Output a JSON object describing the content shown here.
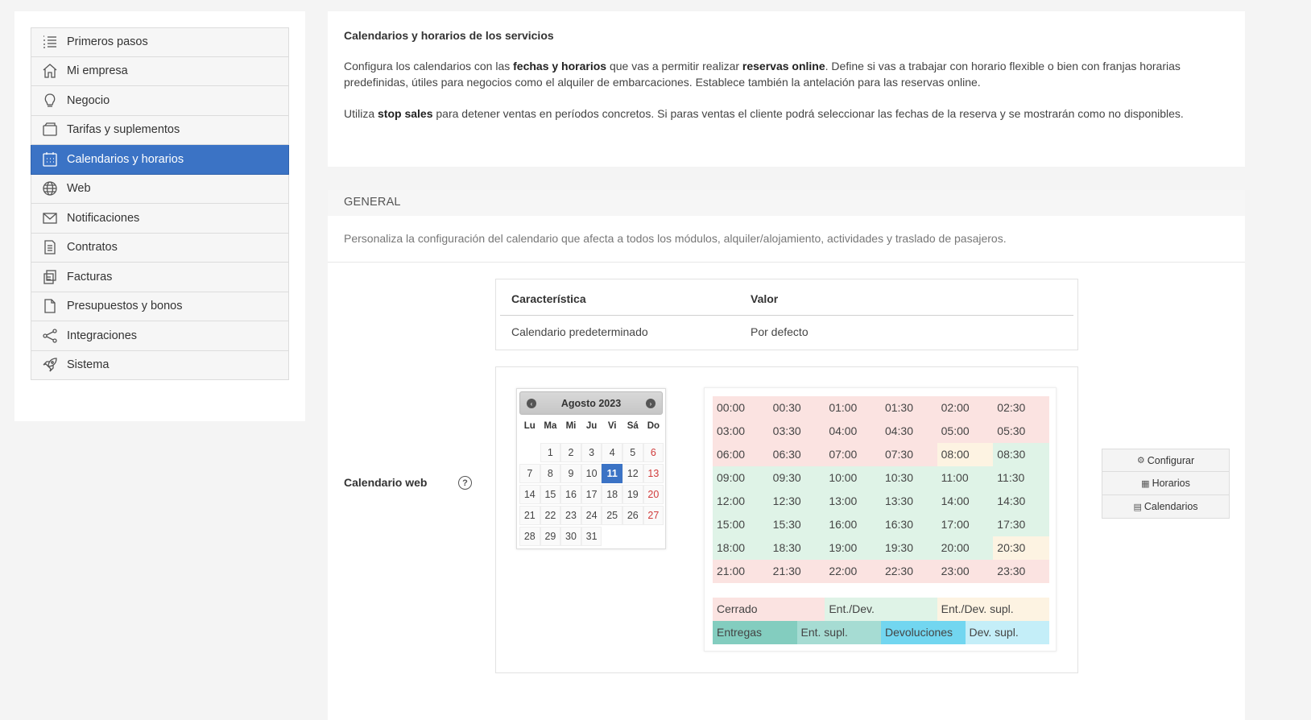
{
  "sidebar": {
    "items": [
      {
        "label": "Primeros pasos",
        "icon": "list-numbered-icon",
        "active": false
      },
      {
        "label": "Mi empresa",
        "icon": "home-icon",
        "active": false
      },
      {
        "label": "Negocio",
        "icon": "lightbulb-icon",
        "active": false
      },
      {
        "label": "Tarifas y suplementos",
        "icon": "wallet-icon",
        "active": false
      },
      {
        "label": "Calendarios y horarios",
        "icon": "calendar-icon",
        "active": true
      },
      {
        "label": "Web",
        "icon": "globe-icon",
        "active": false
      },
      {
        "label": "Notificaciones",
        "icon": "envelope-icon",
        "active": false
      },
      {
        "label": "Contratos",
        "icon": "document-icon",
        "active": false
      },
      {
        "label": "Facturas",
        "icon": "invoices-icon",
        "active": false
      },
      {
        "label": "Presupuestos y bonos",
        "icon": "file-icon",
        "active": false
      },
      {
        "label": "Integraciones",
        "icon": "share-icon",
        "active": false
      },
      {
        "label": "Sistema",
        "icon": "rocket-icon",
        "active": false
      }
    ]
  },
  "intro": {
    "title": "Calendarios y horarios de los servicios",
    "p1_a": "Configura los calendarios con las ",
    "p1_b": "fechas y horarios",
    "p1_c": " que vas a permitir realizar ",
    "p1_d": "reservas online",
    "p1_e": ". Define si vas a trabajar con horario flexible o bien con franjas horarias predefinidas, útiles para negocios como el alquiler de embarcaciones. Establece también la antelación para las reservas online.",
    "p2_a": "Utiliza ",
    "p2_b": "stop sales",
    "p2_c": " para detener ventas en períodos concretos. Si paras ventas el cliente podrá seleccionar las fechas de la reserva y se mostrarán como no disponibles."
  },
  "general": {
    "heading": "GENERAL",
    "description": "Personaliza la configuración del calendario que afecta a todos los módulos, alquiler/alojamiento, actividades y traslado de pasajeros."
  },
  "feature_table": {
    "col1": "Característica",
    "col2": "Valor",
    "row_feature": "Calendario predeterminado",
    "row_value": "Por defecto"
  },
  "calendar_web": {
    "label": "Calendario web",
    "help": "?"
  },
  "datepicker": {
    "month": "Agosto 2023",
    "prev": "‹",
    "next": "›",
    "dows": [
      "Lu",
      "Ma",
      "Mi",
      "Ju",
      "Vi",
      "Sá",
      "Do"
    ],
    "weeks": [
      [
        "",
        "1",
        "2",
        "3",
        "4",
        "5",
        "6"
      ],
      [
        "7",
        "8",
        "9",
        "10",
        "11",
        "12",
        "13"
      ],
      [
        "14",
        "15",
        "16",
        "17",
        "18",
        "19",
        "20"
      ],
      [
        "21",
        "22",
        "23",
        "24",
        "25",
        "26",
        "27"
      ],
      [
        "28",
        "29",
        "30",
        "31",
        "",
        "",
        ""
      ]
    ],
    "selected": "11"
  },
  "time_grid": {
    "rows": [
      [
        [
          "00:00",
          "red"
        ],
        [
          "00:30",
          "red"
        ],
        [
          "01:00",
          "red"
        ],
        [
          "01:30",
          "red"
        ],
        [
          "02:00",
          "red"
        ],
        [
          "02:30",
          "red"
        ]
      ],
      [
        [
          "03:00",
          "red"
        ],
        [
          "03:30",
          "red"
        ],
        [
          "04:00",
          "red"
        ],
        [
          "04:30",
          "red"
        ],
        [
          "05:00",
          "red"
        ],
        [
          "05:30",
          "red"
        ]
      ],
      [
        [
          "06:00",
          "red"
        ],
        [
          "06:30",
          "red"
        ],
        [
          "07:00",
          "red"
        ],
        [
          "07:30",
          "red"
        ],
        [
          "08:00",
          "yellow"
        ],
        [
          "08:30",
          "green"
        ]
      ],
      [
        [
          "09:00",
          "green"
        ],
        [
          "09:30",
          "green"
        ],
        [
          "10:00",
          "green"
        ],
        [
          "10:30",
          "green"
        ],
        [
          "11:00",
          "green"
        ],
        [
          "11:30",
          "green"
        ]
      ],
      [
        [
          "12:00",
          "green"
        ],
        [
          "12:30",
          "green"
        ],
        [
          "13:00",
          "green"
        ],
        [
          "13:30",
          "green"
        ],
        [
          "14:00",
          "green"
        ],
        [
          "14:30",
          "green"
        ]
      ],
      [
        [
          "15:00",
          "green"
        ],
        [
          "15:30",
          "green"
        ],
        [
          "16:00",
          "green"
        ],
        [
          "16:30",
          "green"
        ],
        [
          "17:00",
          "green"
        ],
        [
          "17:30",
          "green"
        ]
      ],
      [
        [
          "18:00",
          "green"
        ],
        [
          "18:30",
          "green"
        ],
        [
          "19:00",
          "green"
        ],
        [
          "19:30",
          "green"
        ],
        [
          "20:00",
          "green"
        ],
        [
          "20:30",
          "yellow"
        ]
      ],
      [
        [
          "21:00",
          "red"
        ],
        [
          "21:30",
          "red"
        ],
        [
          "22:00",
          "red"
        ],
        [
          "22:30",
          "red"
        ],
        [
          "23:00",
          "red"
        ],
        [
          "23:30",
          "red"
        ]
      ]
    ]
  },
  "legend": {
    "row1": [
      {
        "label": "Cerrado",
        "color": "#fbe3e1"
      },
      {
        "label": "Ent./Dev.",
        "color": "#dff3e7"
      },
      {
        "label": "Ent./Dev. supl.",
        "color": "#fdf3e2"
      }
    ],
    "row2": [
      {
        "label": "Entregas",
        "color": "#83cdbf"
      },
      {
        "label": "Ent. supl.",
        "color": "#a6dcd3"
      },
      {
        "label": "Devoluciones",
        "color": "#72d6f0"
      },
      {
        "label": "Dev. supl.",
        "color": "#c4eef8"
      }
    ]
  },
  "actions": {
    "configure": "Configurar",
    "schedules": "Horarios",
    "calendars": "Calendarios"
  },
  "colors": {
    "accent": "#3b73c5",
    "closed": "#fbe3e1",
    "open": "#dff3e7",
    "supplement": "#fdf3e2",
    "sunday": "#d03b3b"
  }
}
